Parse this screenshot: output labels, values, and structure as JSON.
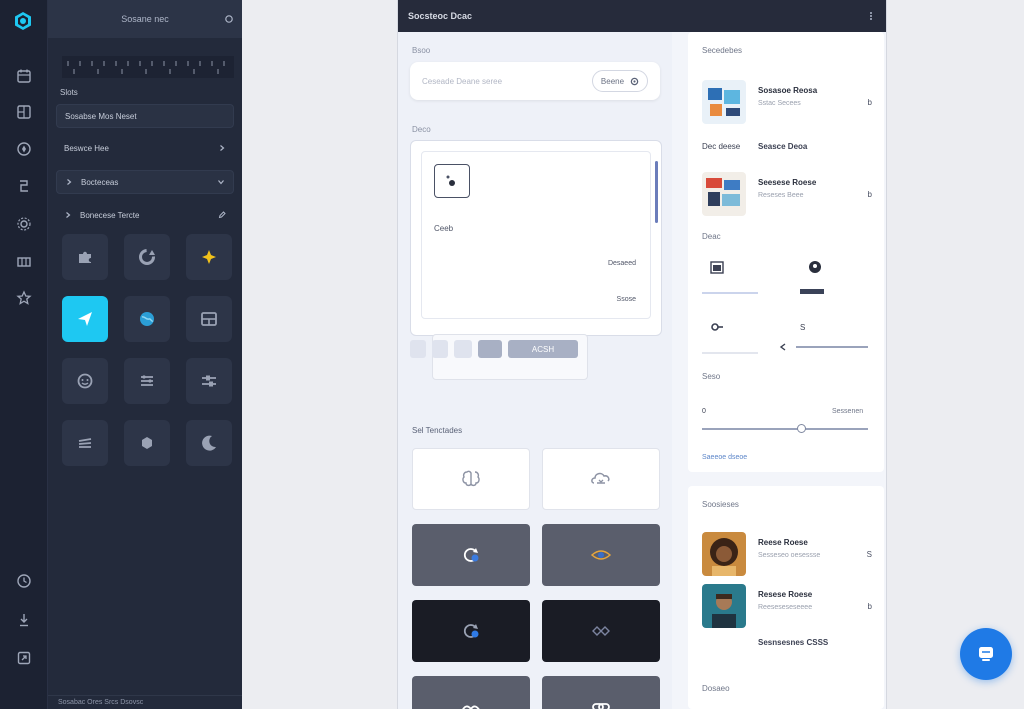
{
  "rail": {
    "icons": [
      "logo-icon",
      "calendar-icon",
      "layout-icon",
      "compass-icon",
      "sliders-icon",
      "gear-icon",
      "table-icon",
      "star-icon",
      "clock-icon",
      "download-icon",
      "export-icon"
    ]
  },
  "panel": {
    "header_title": "Sosane nec",
    "label_1": "Slots",
    "row_1": "Sosabse Mos Neset",
    "row_2": "Beswce Hee",
    "row_3": "Bocteceas",
    "row_4": "Bonecese Tercte",
    "footer_text": "Sosabac Ores Srcs Dsovsc"
  },
  "window": {
    "title": "Socsteoc Dcac",
    "url_label": "Bsoo",
    "url_placeholder": "Ceseade Deane seree",
    "url_button": "Beene",
    "upload_label": "Deco",
    "dropzone_label": "Ceeb",
    "dropzone_r1": "Desaeed",
    "dropzone_r2": "Ssose",
    "chip_label": "ACSH",
    "styles_label": "Sel Tenctades"
  },
  "sidebar_right": {
    "card1_title": "Secedebes",
    "item1_title": "Sosasoe Reosa",
    "item1_sub": "Sstac Secees",
    "item1_action": "b",
    "divider_left": "Dec deese",
    "divider_right": "Seasce Deoa",
    "item2_title": "Seesese Roese",
    "item2_sub": "Reseses Beee",
    "item2_action": "b",
    "settings_label": "Deac",
    "ctl3_value": "S",
    "size_label": "Seso",
    "size_min": "0",
    "size_max": "Sessenen",
    "size_value": 0.6,
    "link_text": "Saeeoe dseoe",
    "card2_title": "Soosieses",
    "person1_title": "Reese Roese",
    "person1_sub": "Sesseseo oesessse",
    "person1_action": "S",
    "person2_title": "Resese Roese",
    "person2_sub": "Reeseseseseeee",
    "person2_action": "b",
    "person2_extra": "Sesnsesnes CSSS",
    "bottom_label": "Dosaeo"
  },
  "colors": {
    "accent": "#1ec8f2",
    "fab": "#1f7ae6",
    "dark_panel": "#232a3b",
    "title_bar": "#262b3b"
  }
}
